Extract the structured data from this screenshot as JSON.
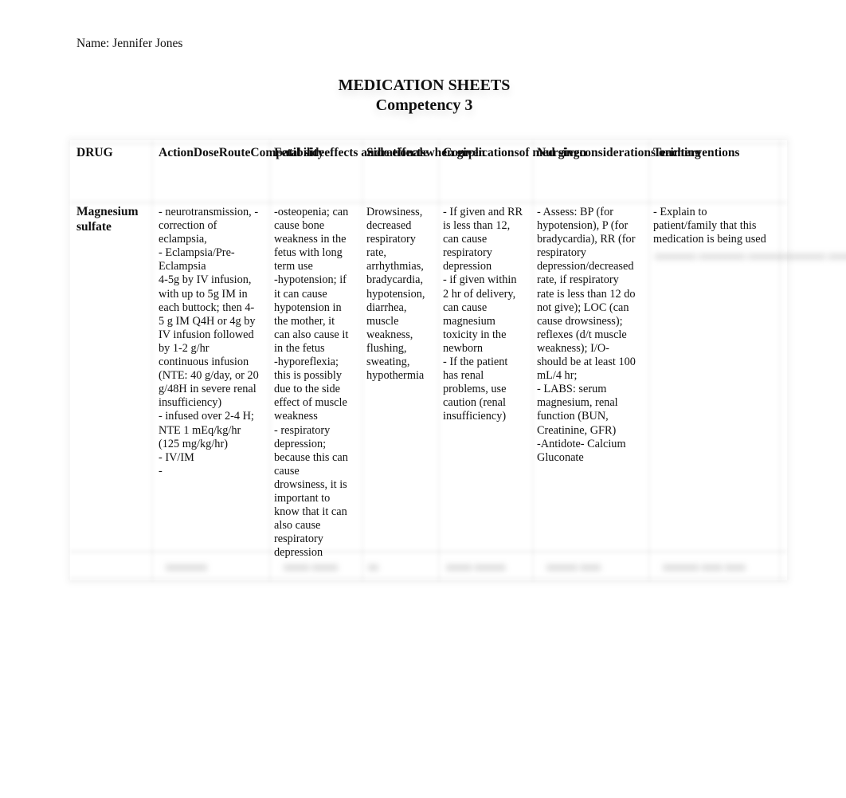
{
  "document": {
    "name_line": "Name: Jennifer Jones",
    "title": "MEDICATION SHEETS",
    "subtitle": "Competency 3"
  },
  "table": {
    "headers": [
      {
        "lines": [
          "DRUG"
        ]
      },
      {
        "lines": [
          "Action",
          "Dose",
          "Route",
          "Compatibility"
        ]
      },
      {
        "lines": [
          "Fetal side",
          "effects and",
          "rationale"
        ]
      },
      {
        "lines": [
          "Side effects",
          "when given"
        ]
      },
      {
        "lines": [
          "Complications",
          "of med given"
        ]
      },
      {
        "lines": [
          "Nursing",
          "considerations or",
          "interventions"
        ]
      },
      {
        "lines": [
          "Teaching"
        ]
      }
    ],
    "rows": [
      {
        "drug": [
          "Magnesium",
          "sulfate"
        ],
        "action_dose_route": [
          "- neurotransmission, -",
          "correction of",
          "eclampsia,",
          "- Eclampsia/Pre-",
          "Eclampsia",
          "4-5g by IV infusion,",
          "with up to 5g IM in",
          "each buttock; then 4-",
          "5 g IM Q4H or 4g by",
          "IV infusion followed",
          "by 1-2 g/hr",
          "continuous infusion",
          "(NTE: 40 g/day, or 20",
          "g/48H in severe renal",
          "insufficiency)",
          "- infused over 2-4 H;",
          "NTE 1 mEq/kg/hr",
          "(125 mg/kg/hr)",
          "- IV/IM",
          "-"
        ],
        "fetal_side_effects": [
          "-osteopenia; can",
          "cause bone",
          "weakness in the",
          "fetus with long",
          "term use",
          "-hypotension; if",
          "it can cause",
          "hypotension in",
          "the mother, it",
          "can also cause it",
          "in the fetus",
          "-hyporeflexia;",
          "this is possibly",
          "due to the side",
          "effect of muscle",
          "weakness",
          "- respiratory",
          "depression;",
          "because this can",
          "cause",
          "drowsiness, it is",
          "important to",
          "know that it can",
          "also cause",
          "respiratory",
          "depression"
        ],
        "side_effects": [
          "Drowsiness,",
          "decreased",
          "respiratory",
          "rate,",
          "arrhythmias,",
          "bradycardia,",
          "hypotension,",
          "diarrhea,",
          "muscle",
          "weakness,",
          "flushing,",
          "sweating,",
          "hypothermia"
        ],
        "complications": [
          "- If given and RR",
          "is less than 12,",
          "can cause",
          "respiratory",
          "depression",
          "- if given within",
          "2 hr of delivery,",
          "can cause",
          "magnesium",
          "toxicity in the",
          "newborn",
          "- If the patient",
          "has renal",
          "problems, use",
          "caution (renal",
          "insufficiency)"
        ],
        "nursing": [
          "-  Assess: BP (for",
          "hypotension), P (for",
          "bradycardia), RR (for",
          "respiratory",
          "depression/decreased",
          "rate, if respiratory",
          "rate is less than 12 do",
          "not give); LOC (can",
          "cause drowsiness);",
          "reflexes (d/t muscle",
          "weakness); I/O-",
          "should be at least 100",
          "mL/4 hr;",
          "- LABS: serum",
          "magnesium, renal",
          "function (BUN,",
          "Creatinine, GFR)",
          "-Antidote- Calcium",
          "Gluconate"
        ],
        "teaching": [
          "- Explain to",
          "patient/family that this",
          "medication is being used"
        ],
        "teaching_obscured": [
          "xxxxxxxx xxxxxxxxx xxxx",
          "xxxxxxxxxxx xxxxxx xxxxx",
          "xxxxxx xxxxxxxxxx",
          "xxxxx xxxxxxxxxx xx",
          "xxxxxxxxxxx",
          "xxxxxxxx"
        ]
      }
    ],
    "obscured_row": [
      "",
      "xxxxxxxx",
      "xxxxx xxxxx",
      "xx",
      "xxxxx xxxxxx",
      "xxxxxx xxxx",
      "xxxxxxx xxxx xxxx"
    ]
  }
}
